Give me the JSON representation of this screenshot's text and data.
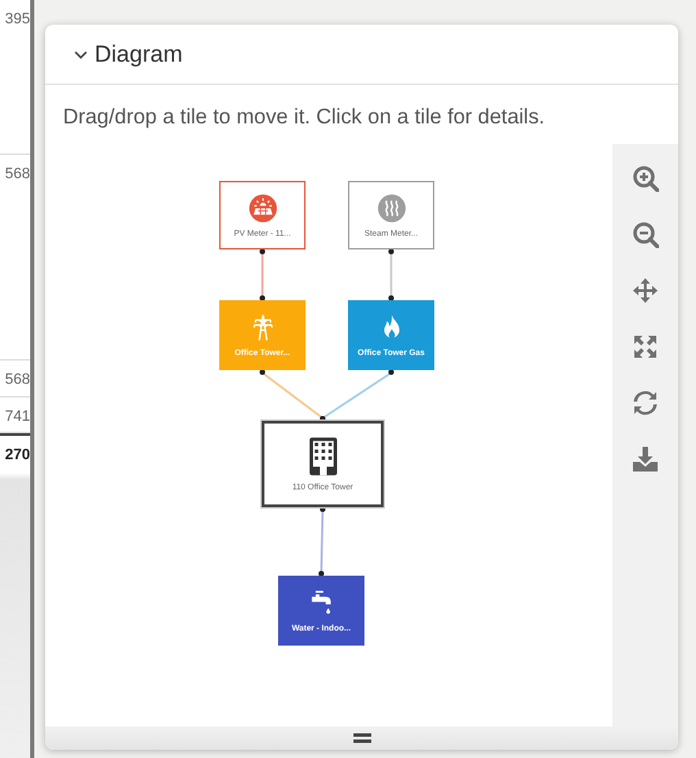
{
  "background_table": {
    "rows": [
      {
        "value": "395",
        "kind": "value"
      },
      {
        "value": "568",
        "kind": "value"
      },
      {
        "value": "568",
        "kind": "value"
      },
      {
        "value": "741",
        "kind": "value"
      },
      {
        "value": "270",
        "kind": "total"
      }
    ]
  },
  "panel": {
    "title": "Diagram",
    "expanded": true,
    "instructions": "Drag/drop a tile to move it. Click on a tile for details.",
    "nodes": [
      {
        "label": "PV Meter - 11...",
        "kind": "meter",
        "color": "#e8553a"
      },
      {
        "label": "Steam Meter...",
        "kind": "meter",
        "color": "#9e9e9e"
      },
      {
        "label": "Office Tower...",
        "kind": "utility",
        "color": "#fbaa0b"
      },
      {
        "label": "Office Tower Gas",
        "kind": "utility",
        "color": "#1a9ad6"
      },
      {
        "label": "110 Office Tower",
        "kind": "building",
        "color": "#333333"
      },
      {
        "label": "Water - Indoo...",
        "kind": "utility",
        "color": "#3f51c0"
      }
    ],
    "edges": [
      {
        "color": "#f4a6a0"
      },
      {
        "color": "#c8c8c8"
      },
      {
        "color": "#f8c88a"
      },
      {
        "color": "#9fd0ea"
      },
      {
        "color": "#a9b4e4"
      }
    ],
    "tools": [
      {
        "kind": "zoom-in"
      },
      {
        "kind": "zoom-out"
      },
      {
        "kind": "move"
      },
      {
        "kind": "fit"
      },
      {
        "kind": "refresh"
      },
      {
        "kind": "download"
      }
    ]
  }
}
